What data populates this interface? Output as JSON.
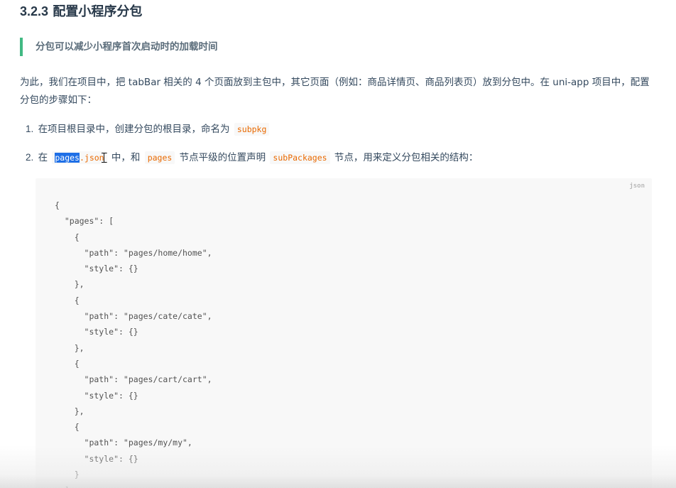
{
  "heading": {
    "number": "3.2.3",
    "title": "配置小程序分包"
  },
  "tip": {
    "text": "分包可以减少小程序首次启动时的加载时间"
  },
  "intro": {
    "text": "为此，我们在项目中，把 tabBar 相关的 4 个页面放到主包中，其它页面（例如：商品详情页、商品列表页）放到分包中。在 uni-app 项目中，配置分包的步骤如下："
  },
  "steps": [
    {
      "number": "1.",
      "text_before": "在项目根目录中，创建分包的根目录，命名为",
      "code": "subpkg"
    },
    {
      "number": "2.",
      "text_1": "在",
      "code_1_selected": "pages",
      "code_1_rest": ".json",
      "text_2": "中，和",
      "code_2": "pages",
      "text_3": "节点平级的位置声明",
      "code_3": "subPackages",
      "text_4": "节点，用来定义分包相关的结构："
    }
  ],
  "code_block": {
    "language": "json",
    "lines": [
      "{",
      "  \"pages\": [",
      "    {",
      "      \"path\": \"pages/home/home\",",
      "      \"style\": {}",
      "    },",
      "    {",
      "      \"path\": \"pages/cate/cate\",",
      "      \"style\": {}",
      "    },",
      "    {",
      "      \"path\": \"pages/cart/cart\",",
      "      \"style\": {}",
      "    },",
      "    {",
      "      \"path\": \"pages/my/my\",",
      "      \"style\": {}",
      "    }",
      "  ],"
    ]
  },
  "colors": {
    "accent": "#42b983",
    "inline_code": "#e96900",
    "selection": "#1e6fe6"
  }
}
